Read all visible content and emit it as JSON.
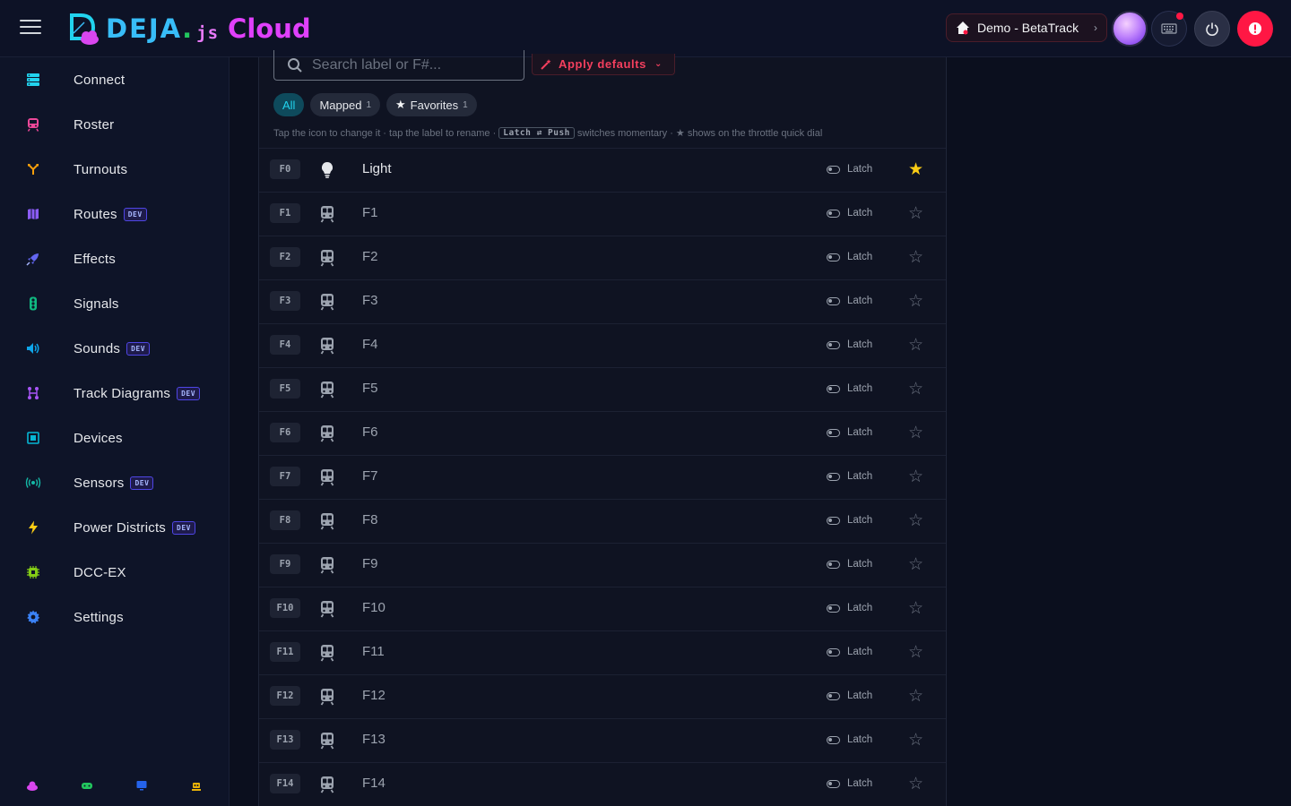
{
  "header": {
    "logo_main": "DEJA",
    "logo_dot": ".",
    "logo_js": "js",
    "logo_cloud": "Cloud",
    "layout_label": "Demo - BetaTrack",
    "layout_chevron": "›"
  },
  "sidebar": {
    "items": [
      {
        "label": "Connect",
        "icon": "server-icon",
        "color": "#22d3ee",
        "dev": ""
      },
      {
        "label": "Roster",
        "icon": "train-icon",
        "color": "#ec4899",
        "dev": ""
      },
      {
        "label": "Turnouts",
        "icon": "fork-icon",
        "color": "#f59e0b",
        "dev": ""
      },
      {
        "label": "Routes",
        "icon": "map-icon",
        "color": "#8b5cf6",
        "dev": "DEV"
      },
      {
        "label": "Effects",
        "icon": "rocket-icon",
        "color": "#6366f1",
        "dev": ""
      },
      {
        "label": "Signals",
        "icon": "traffic-light-icon",
        "color": "#10b981",
        "dev": ""
      },
      {
        "label": "Sounds",
        "icon": "speaker-icon",
        "color": "#0ea5e9",
        "dev": "DEV"
      },
      {
        "label": "Track Diagrams",
        "icon": "diagram-icon",
        "color": "#a855f7",
        "dev": "DEV"
      },
      {
        "label": "Devices",
        "icon": "chip-icon",
        "color": "#06b6d4",
        "dev": ""
      },
      {
        "label": "Sensors",
        "icon": "broadcast-icon",
        "color": "#14b8a6",
        "dev": "DEV"
      },
      {
        "label": "Power Districts",
        "icon": "bolt-icon",
        "color": "#facc15",
        "dev": "DEV"
      },
      {
        "label": "DCC-EX",
        "icon": "cpu-icon",
        "color": "#84cc16",
        "dev": ""
      },
      {
        "label": "Settings",
        "icon": "gear-icon",
        "color": "#3b82f6",
        "dev": ""
      }
    ],
    "footer_icons": [
      "cloud-icon",
      "gamepad-icon",
      "monitor-icon",
      "robot-icon"
    ]
  },
  "functions": {
    "search_placeholder": "Search label or F#...",
    "apply_defaults": "Apply defaults",
    "filters": {
      "all": "All",
      "mapped": "Mapped",
      "mapped_count": "1",
      "favorites": "Favorites",
      "favorites_count": "1"
    },
    "hint": {
      "part1": "Tap the icon to change it · tap the label to rename ·",
      "kbd": "Latch ⇄ Push",
      "part2": "switches momentary · ★ shows on the throttle quick dial"
    },
    "rows": [
      {
        "f": "F0",
        "label": "Light",
        "mode": "Latch",
        "icon": "lightbulb-icon",
        "fav": true
      },
      {
        "f": "F1",
        "label": "F1",
        "mode": "Latch",
        "icon": "train-icon",
        "fav": false
      },
      {
        "f": "F2",
        "label": "F2",
        "mode": "Latch",
        "icon": "train-icon",
        "fav": false
      },
      {
        "f": "F3",
        "label": "F3",
        "mode": "Latch",
        "icon": "train-icon",
        "fav": false
      },
      {
        "f": "F4",
        "label": "F4",
        "mode": "Latch",
        "icon": "train-icon",
        "fav": false
      },
      {
        "f": "F5",
        "label": "F5",
        "mode": "Latch",
        "icon": "train-icon",
        "fav": false
      },
      {
        "f": "F6",
        "label": "F6",
        "mode": "Latch",
        "icon": "train-icon",
        "fav": false
      },
      {
        "f": "F7",
        "label": "F7",
        "mode": "Latch",
        "icon": "train-icon",
        "fav": false
      },
      {
        "f": "F8",
        "label": "F8",
        "mode": "Latch",
        "icon": "train-icon",
        "fav": false
      },
      {
        "f": "F9",
        "label": "F9",
        "mode": "Latch",
        "icon": "train-icon",
        "fav": false
      },
      {
        "f": "F10",
        "label": "F10",
        "mode": "Latch",
        "icon": "train-icon",
        "fav": false
      },
      {
        "f": "F11",
        "label": "F11",
        "mode": "Latch",
        "icon": "train-icon",
        "fav": false
      },
      {
        "f": "F12",
        "label": "F12",
        "mode": "Latch",
        "icon": "train-icon",
        "fav": false
      },
      {
        "f": "F13",
        "label": "F13",
        "mode": "Latch",
        "icon": "train-icon",
        "fav": false
      },
      {
        "f": "F14",
        "label": "F14",
        "mode": "Latch",
        "icon": "train-icon",
        "fav": false
      }
    ]
  }
}
